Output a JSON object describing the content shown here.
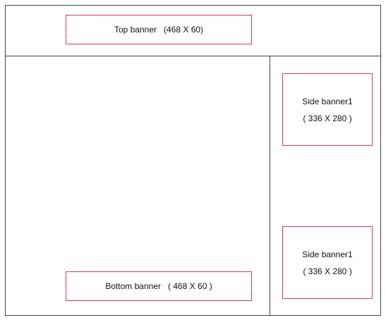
{
  "colors": {
    "frame_line": "#444444",
    "banner_border": "#d23a6a",
    "background": "#ffffff"
  },
  "banners": {
    "top": {
      "text": "Top banner   (468 X 60)"
    },
    "bottom": {
      "text": "Bottom banner   ( 468 X 60 )"
    },
    "side1": {
      "line1": "Side banner1",
      "line2": "( 336 X 280 )"
    },
    "side2": {
      "line1": "Side banner1",
      "line2": "( 336 X 280 )"
    }
  }
}
